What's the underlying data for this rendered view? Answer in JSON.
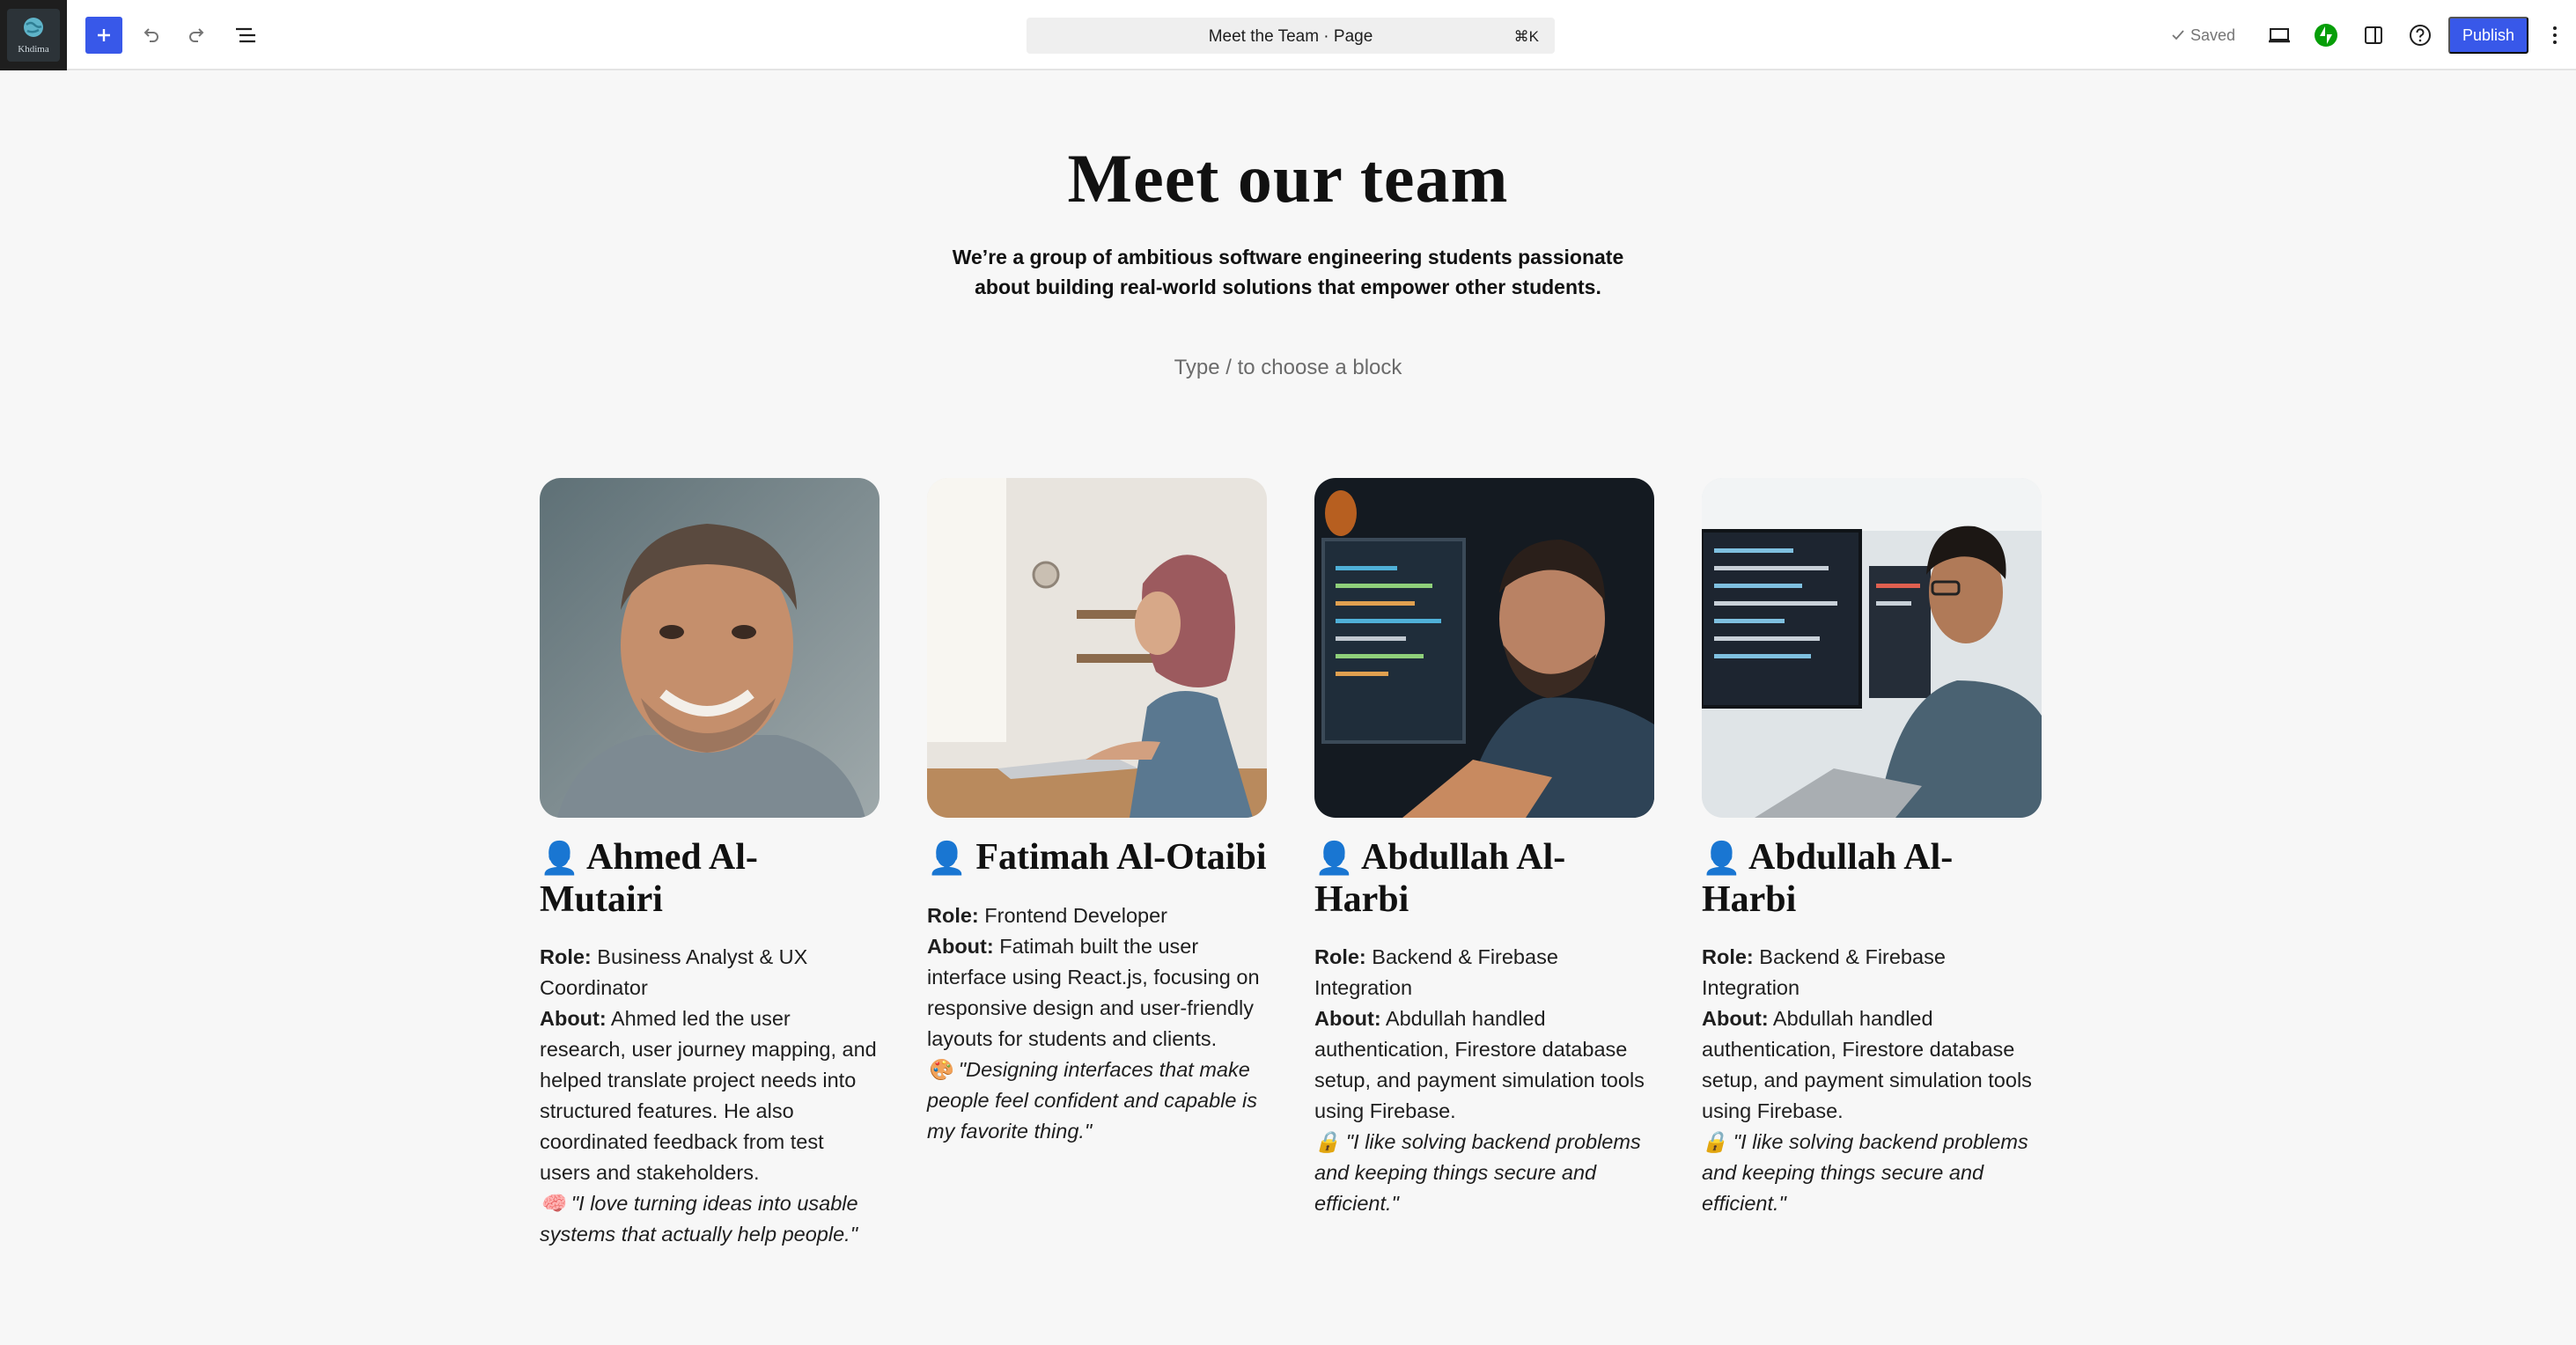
{
  "toolbar": {
    "site_logo_text": "Khdima",
    "document_title": "Meet the Team · Page",
    "shortcut": "⌘K",
    "saved_label": "Saved",
    "publish_label": "Publish",
    "accent_color": "#3858e9"
  },
  "page": {
    "heading": "Meet our team",
    "intro": "We’re a group of ambitious software engineering students passionate about building real-world solutions that empower other students.",
    "block_placeholder": "Type / to choose a block"
  },
  "team": [
    {
      "emoji": "👤",
      "name": "Ahmed Al-Mutairi",
      "role_label": "Role:",
      "role": "Business Analyst & UX Coordinator",
      "about_label": "About:",
      "about": "Ahmed led the user research, user journey mapping, and helped translate project needs into structured features. He also coordinated feedback from test users and stakeholders.",
      "quote_emoji": "🧠",
      "quote": "\"I love turning ideas into usable systems that actually help people.\""
    },
    {
      "emoji": "👤",
      "name": "Fatimah Al-Otaibi",
      "role_label": "Role:",
      "role": "Frontend Developer",
      "about_label": "About:",
      "about": "Fatimah built the user interface using React.js, focusing on responsive design and user-friendly layouts for students and clients.",
      "quote_emoji": "🎨",
      "quote": "\"Designing interfaces that make people feel confident and capable is my favorite thing.\""
    },
    {
      "emoji": "👤",
      "name": "Abdullah Al-Harbi",
      "role_label": "Role:",
      "role": "Backend & Firebase Integration",
      "about_label": "About:",
      "about": "Abdullah handled authentication, Firestore database setup, and payment simulation tools using Firebase.",
      "quote_emoji": "🔒",
      "quote": "\"I like solving backend problems and keeping things secure and efficient.\""
    },
    {
      "emoji": "👤",
      "name": "Abdullah Al-Harbi",
      "role_label": "Role:",
      "role": "Backend & Firebase Integration",
      "about_label": "About:",
      "about": "Abdullah handled authentication, Firestore database setup, and payment simulation tools using Firebase.",
      "quote_emoji": "🔒",
      "quote": "\"I like solving backend problems and keeping things secure and efficient.\""
    }
  ]
}
